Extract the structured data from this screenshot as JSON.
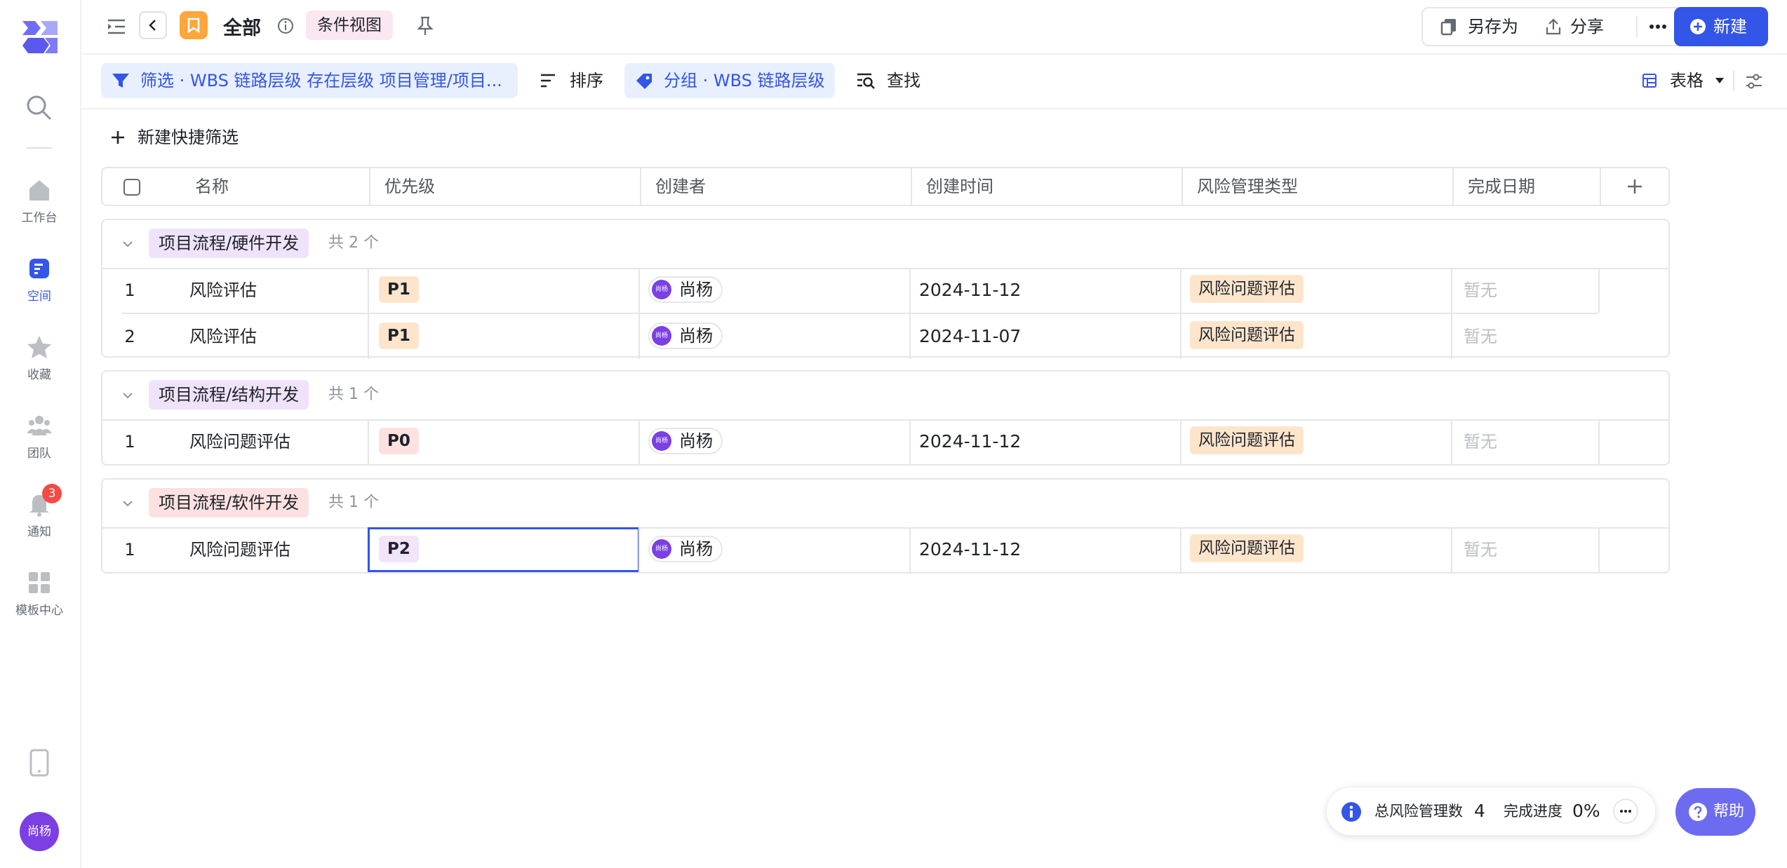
{
  "rail": {
    "items": [
      {
        "label": "工作台"
      },
      {
        "label": "空间"
      },
      {
        "label": "收藏"
      },
      {
        "label": "团队"
      },
      {
        "label": "通知",
        "badge": "3"
      },
      {
        "label": "模板中心"
      }
    ],
    "user": "尚杨"
  },
  "header": {
    "title": "全部",
    "view_tag": "条件视图",
    "save_as": "另存为",
    "share": "分享",
    "new_button": "新建"
  },
  "toolbar": {
    "filter": "筛选 · WBS 链路层级 存在层级 项目管理/项目...",
    "sort": "排序",
    "group": "分组 · WBS 链路层级",
    "find": "查找",
    "view_type": "表格"
  },
  "quick_filter": "新建快捷筛选",
  "table": {
    "columns": [
      "名称",
      "优先级",
      "创建者",
      "创建时间",
      "风险管理类型",
      "完成日期"
    ],
    "groups": [
      {
        "name": "项目流程/硬件开发",
        "color": "#efe3fb",
        "count": "共 2 个",
        "rows": [
          {
            "num": "1",
            "name": "风险评估",
            "priority": "P1",
            "priority_color": "#fde5cc",
            "creator": "尚杨",
            "avatar": "尚杨",
            "created": "2024-11-12",
            "risk_type": "风险问题评估",
            "done": "暂无"
          },
          {
            "num": "2",
            "name": "风险评估",
            "priority": "P1",
            "priority_color": "#fde5cc",
            "creator": "尚杨",
            "avatar": "尚杨",
            "created": "2024-11-07",
            "risk_type": "风险问题评估",
            "done": "暂无"
          }
        ]
      },
      {
        "name": "项目流程/结构开发",
        "color": "#efe3fb",
        "count": "共 1 个",
        "rows": [
          {
            "num": "1",
            "name": "风险问题评估",
            "priority": "P0",
            "priority_color": "#fde1e1",
            "creator": "尚杨",
            "avatar": "尚杨",
            "created": "2024-11-12",
            "risk_type": "风险问题评估",
            "done": "暂无"
          }
        ]
      },
      {
        "name": "项目流程/软件开发",
        "color": "#fde1e1",
        "count": "共 1 个",
        "rows": [
          {
            "num": "1",
            "name": "风险问题评估",
            "priority": "P2",
            "priority_color": "#f1e4fb",
            "creator": "尚杨",
            "avatar": "尚杨",
            "created": "2024-11-12",
            "risk_type": "风险问题评估",
            "done": "暂无"
          }
        ]
      }
    ]
  },
  "stats": {
    "total_label": "总风险管理数",
    "total_value": "4",
    "progress_label": "完成进度",
    "progress_value": "0%"
  },
  "help": "帮助",
  "colors": {
    "accent": "#3355e8",
    "avatar": "#7b3fe4",
    "risk_tag": "#fde5cc"
  }
}
